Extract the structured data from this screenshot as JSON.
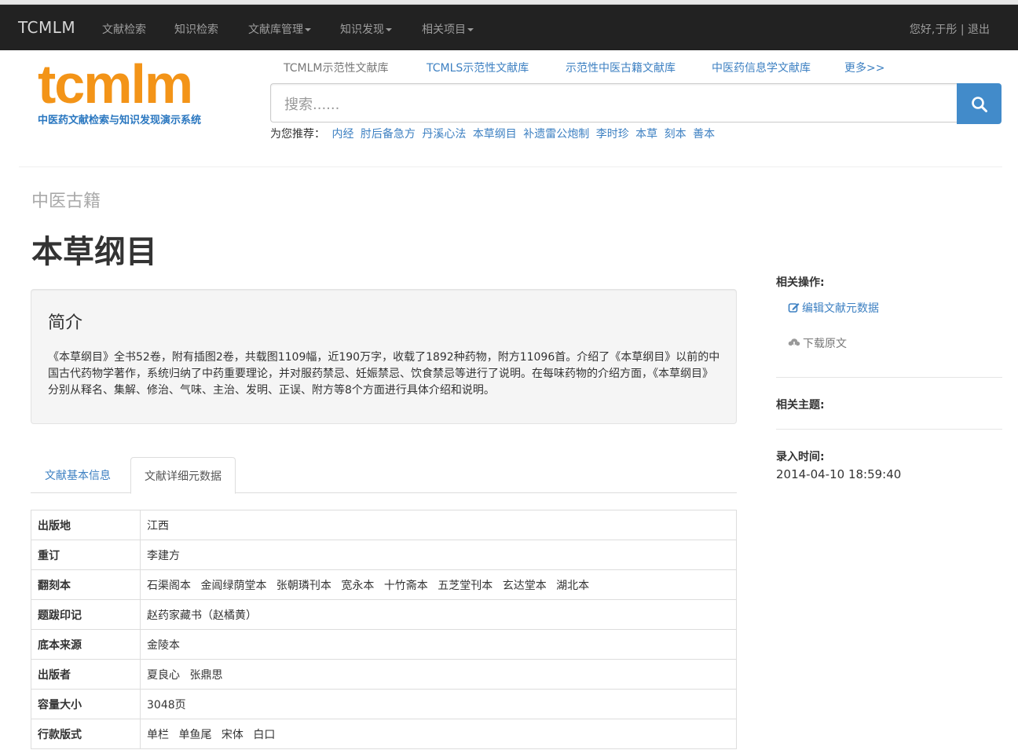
{
  "navbar": {
    "brand": "TCMLM",
    "items": [
      {
        "label": "文献检索",
        "dropdown": false
      },
      {
        "label": "知识检索",
        "dropdown": false
      },
      {
        "label": "文献库管理",
        "dropdown": true
      },
      {
        "label": "知识发现",
        "dropdown": true
      },
      {
        "label": "相关项目",
        "dropdown": true
      }
    ],
    "user_greeting": "您好,于彤",
    "separator": "|",
    "logout": "退出"
  },
  "logo": {
    "text": "tcmlm",
    "subtitle": "中医药文献检索与知识发现演示系统"
  },
  "db_links": [
    "TCMLM示范性文献库",
    "TCMLS示范性文献库",
    "示范性中医古籍文献库",
    "中医药信息学文献库",
    "更多>>"
  ],
  "search": {
    "placeholder": "搜索......",
    "button_icon": "search-icon"
  },
  "recommend": {
    "label": "为您推荐：",
    "keywords": [
      "内经",
      "肘后备急方",
      "丹溪心法",
      "本草纲目",
      "补遗雷公炮制",
      "李时珍",
      "本草",
      "刻本",
      "善本"
    ]
  },
  "page": {
    "category": "中医古籍",
    "title": "本草纲目"
  },
  "intro": {
    "heading": "简介",
    "text": "《本草纲目》全书52卷，附有插图2卷，共载图1109幅，近190万字，收载了1892种药物，附方11096首。介绍了《本草纲目》以前的中国古代药物学著作，系统归纳了中药重要理论，并对服药禁忌、妊娠禁忌、饮食禁忌等进行了说明。在每味药物的介绍方面，《本草纲目》分别从释名、集解、修治、气味、主治、发明、正误、附方等8个方面进行具体介绍和说明。"
  },
  "tabs": [
    {
      "label": "文献基本信息",
      "active": false
    },
    {
      "label": "文献详细元数据",
      "active": true
    }
  ],
  "metadata": [
    {
      "key": "出版地",
      "values": [
        "江西"
      ]
    },
    {
      "key": "重订",
      "values": [
        "李建方"
      ]
    },
    {
      "key": "翻刻本",
      "values": [
        "石渠阁本",
        "金阊绿荫堂本",
        "张朝璘刊本",
        "宽永本",
        "十竹斋本",
        "五芝堂刊本",
        "玄达堂本",
        "湖北本"
      ]
    },
    {
      "key": "题跋印记",
      "values": [
        "赵药家藏书（赵橘黄）"
      ]
    },
    {
      "key": "底本来源",
      "values": [
        "金陵本"
      ]
    },
    {
      "key": "出版者",
      "values": [
        "夏良心",
        "张鼎思"
      ]
    },
    {
      "key": "容量大小",
      "values": [
        "3048页"
      ]
    },
    {
      "key": "行款版式",
      "values": [
        "单栏",
        "单鱼尾",
        "宋体",
        "白口"
      ]
    }
  ],
  "sidebar": {
    "actions_heading": "相关操作:",
    "edit_label": "编辑文献元数据",
    "download_label": "下载原文",
    "topics_heading": "相关主题:",
    "time_heading": "录入时间:",
    "time_value": "2014-04-10 18:59:40"
  },
  "colors": {
    "navbar_bg": "#222222",
    "link": "#3d80c2",
    "logo_orange": "#f39418",
    "logo_blue": "#2a77c0",
    "search_button": "#428bca"
  }
}
